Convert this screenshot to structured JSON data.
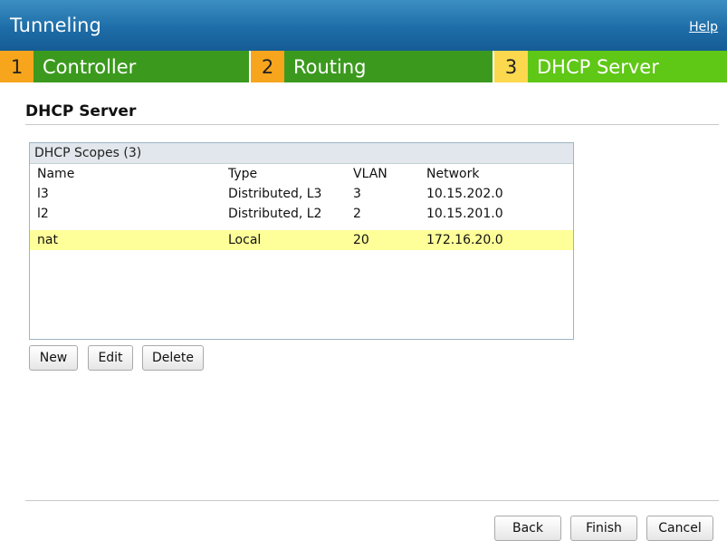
{
  "header": {
    "title": "Tunneling",
    "help": "Help"
  },
  "steps": [
    {
      "number": "1",
      "label": "Controller",
      "state": "inactive"
    },
    {
      "number": "2",
      "label": "Routing",
      "state": "inactive"
    },
    {
      "number": "3",
      "label": "DHCP Server",
      "state": "active"
    }
  ],
  "section": {
    "title": "DHCP Server"
  },
  "scopes": {
    "caption": "DHCP Scopes (3)",
    "columns": [
      "Name",
      "Type",
      "VLAN",
      "Network"
    ],
    "rows": [
      [
        "l3",
        "Distributed, L3",
        "3",
        "10.15.202.0"
      ],
      [
        "l2",
        "Distributed, L2",
        "2",
        "10.15.201.0"
      ],
      [
        "nat",
        "Local",
        "20",
        "172.16.20.0"
      ]
    ],
    "selected_row": 2
  },
  "actions": {
    "new": "New",
    "edit": "Edit",
    "delete": "Delete"
  },
  "footer": {
    "back": "Back",
    "finish": "Finish",
    "cancel": "Cancel"
  },
  "colors": {
    "title_bar": "#1e6da8",
    "step_number_inactive": "#f7a51d",
    "step_label_inactive": "#3b9a1e",
    "step_number_active": "#fbd84d",
    "step_label_active": "#5fc716",
    "selected_row": "#ffff99"
  }
}
